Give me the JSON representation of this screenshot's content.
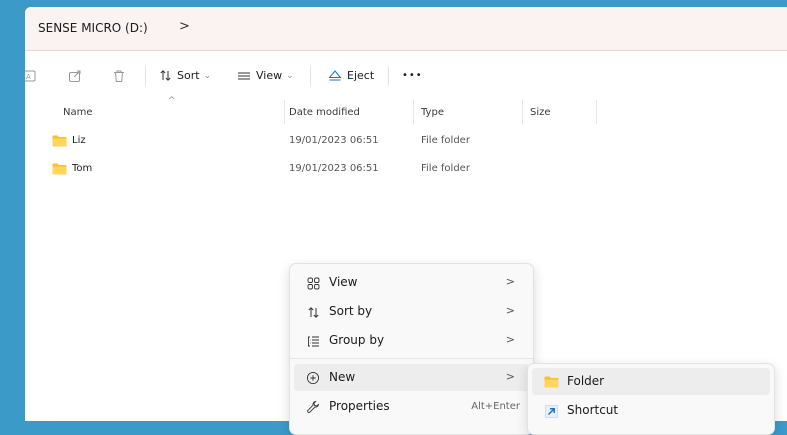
{
  "address": {
    "drive": "SENSE MICRO (D:)",
    "separator": ">"
  },
  "toolbar": {
    "sort_label": "Sort",
    "view_label": "View",
    "eject_label": "Eject",
    "more_label": "•••",
    "dropdown_glyph": "⌄"
  },
  "columns": {
    "name": "Name",
    "date_modified": "Date modified",
    "type": "Type",
    "size": "Size"
  },
  "files": [
    {
      "name": "Liz",
      "date_modified": "19/01/2023 06:51",
      "type": "File folder",
      "icon": "folder-icon"
    },
    {
      "name": "Tom",
      "date_modified": "19/01/2023 06:51",
      "type": "File folder",
      "icon": "folder-icon"
    }
  ],
  "context_menu": {
    "items": [
      {
        "label": "View",
        "icon": "view-grid-icon",
        "chevron": ">"
      },
      {
        "label": "Sort by",
        "icon": "sort-icon",
        "chevron": ">"
      },
      {
        "label": "Group by",
        "icon": "group-by-icon",
        "chevron": ">"
      },
      {
        "label": "New",
        "icon": "new-plus-icon",
        "chevron": ">"
      },
      {
        "label": "Properties",
        "icon": "wrench-icon",
        "shortcut": "Alt+Enter"
      }
    ]
  },
  "submenu_new": {
    "items": [
      {
        "label": "Folder",
        "icon": "folder-icon"
      },
      {
        "label": "Shortcut",
        "icon": "shortcut-icon"
      }
    ]
  },
  "colors": {
    "desktop": "#3c9ac9",
    "address_bar": "#fbf3f2",
    "folder_yellow": "#f6c02f",
    "accent_blue": "#1a73c7",
    "menu_highlight": "#ededed"
  }
}
